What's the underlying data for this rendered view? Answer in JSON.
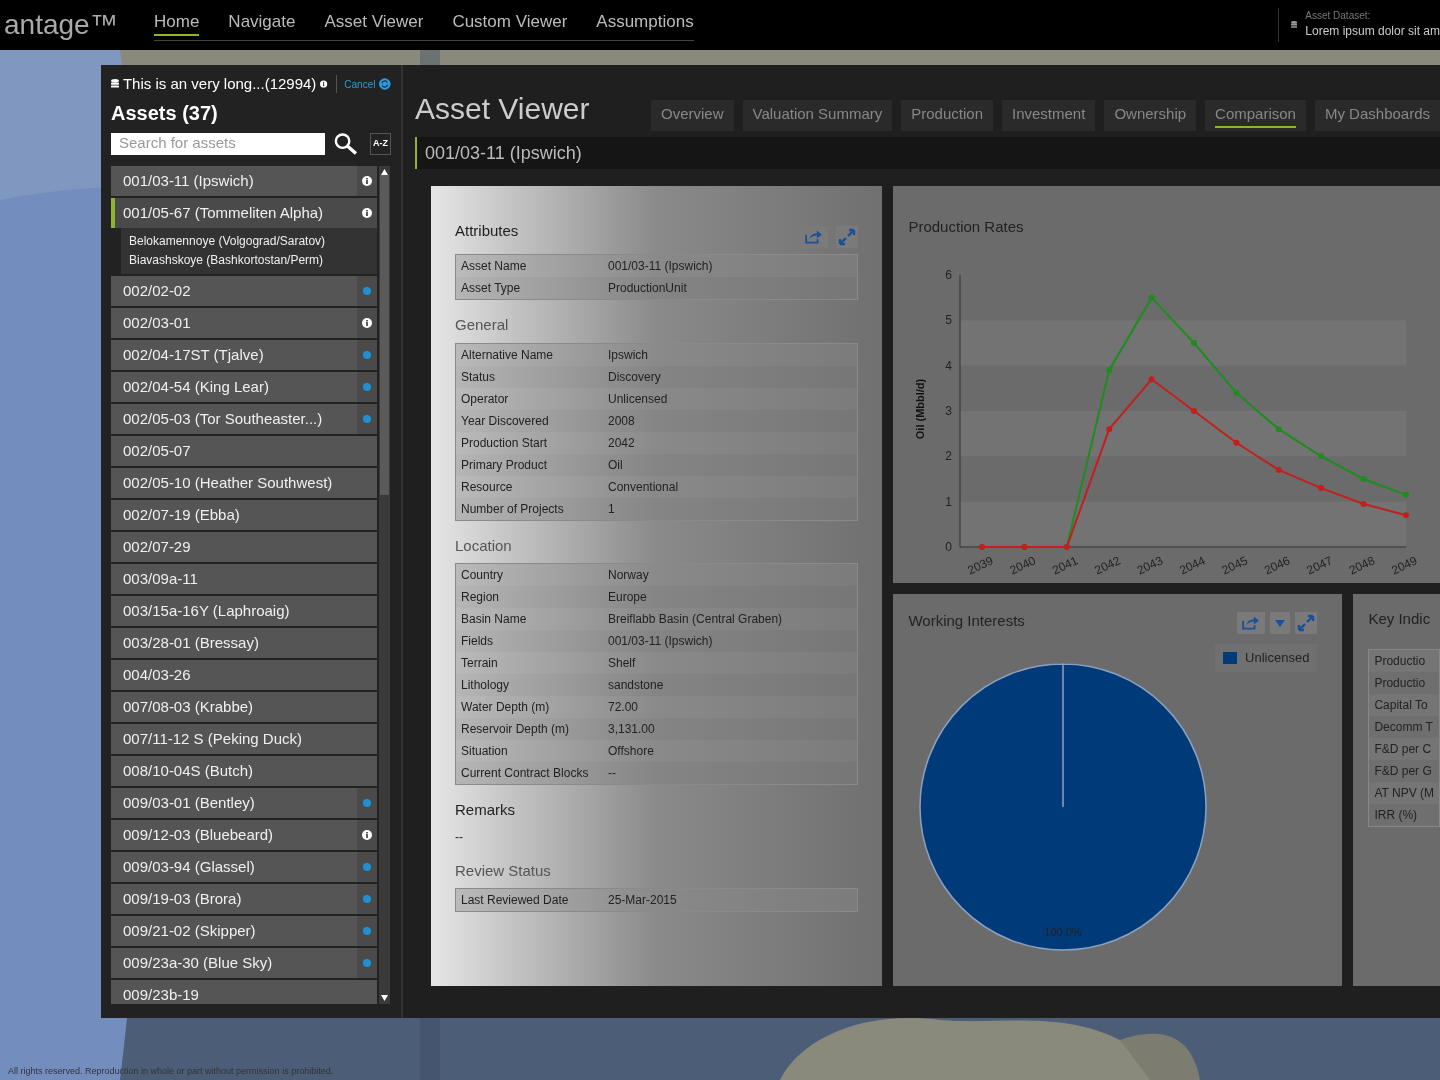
{
  "brand": "antage™",
  "nav": [
    {
      "label": "Home",
      "selected": true
    },
    {
      "label": "Navigate",
      "selected": false
    },
    {
      "label": "Asset Viewer",
      "selected": false
    },
    {
      "label": "Custom Viewer",
      "selected": false
    },
    {
      "label": "Assumptions",
      "selected": false
    }
  ],
  "dataset": {
    "label": "Asset Dataset:",
    "value": "Lorem ipsum dolor sit am"
  },
  "sidebar": {
    "dataset_name": "This is an very long...(12994)",
    "cancel": "Cancel",
    "title": "Assets (37)",
    "search": {
      "placeholder": "Search for assets"
    },
    "sort": "A-Z",
    "items": [
      {
        "label": "001/03-11 (Ipswich)",
        "kind": "info",
        "selected": false
      },
      {
        "label": "001/05-67 (Tommeliten Alpha)",
        "kind": "info",
        "selected": true,
        "expanded": true,
        "children": [
          "Belokamennoye (Volgograd/Saratov)",
          "Biavashskoye (Bashkortostan/Perm)"
        ]
      },
      {
        "label": "002/02-02",
        "kind": "loaded",
        "selected": false
      },
      {
        "label": "002/03-01",
        "kind": "info",
        "selected": false
      },
      {
        "label": "002/04-17ST (Tjalve)",
        "kind": "loaded",
        "selected": false
      },
      {
        "label": "002/04-54 (King Lear)",
        "kind": "loaded",
        "selected": false
      },
      {
        "label": "002/05-03 (Tor Southeaster...)",
        "kind": "loaded",
        "selected": false
      },
      {
        "label": "002/05-07",
        "kind": "plain",
        "selected": false
      },
      {
        "label": "002/05-10 (Heather Southwest)",
        "kind": "plain",
        "selected": false
      },
      {
        "label": "002/07-19 (Ebba)",
        "kind": "plain",
        "selected": false
      },
      {
        "label": "002/07-29",
        "kind": "plain",
        "selected": false
      },
      {
        "label": "003/09a-11",
        "kind": "plain",
        "selected": false
      },
      {
        "label": "003/15a-16Y (Laphroaig)",
        "kind": "plain",
        "selected": false
      },
      {
        "label": "003/28-01 (Bressay)",
        "kind": "plain",
        "selected": false
      },
      {
        "label": "004/03-26",
        "kind": "plain",
        "selected": false
      },
      {
        "label": "007/08-03 (Krabbe)",
        "kind": "plain",
        "selected": false
      },
      {
        "label": "007/11-12 S (Peking Duck)",
        "kind": "plain",
        "selected": false
      },
      {
        "label": "008/10-04S (Butch)",
        "kind": "plain",
        "selected": false
      },
      {
        "label": "009/03-01 (Bentley)",
        "kind": "loaded",
        "selected": false
      },
      {
        "label": "009/12-03 (Bluebeard)",
        "kind": "info",
        "selected": false
      },
      {
        "label": "009/03-94 (Glassel)",
        "kind": "loaded",
        "selected": false
      },
      {
        "label": "009/19-03 (Brora)",
        "kind": "loaded",
        "selected": false
      },
      {
        "label": "009/21-02 (Skipper)",
        "kind": "loaded",
        "selected": false
      },
      {
        "label": "009/23a-30 (Blue Sky)",
        "kind": "loaded",
        "selected": false
      },
      {
        "label": "009/23b-19",
        "kind": "plain",
        "selected": false
      }
    ]
  },
  "viewer": {
    "title": "Asset Viewer",
    "tabs": [
      {
        "label": "Overview",
        "selected": false
      },
      {
        "label": "Valuation Summary",
        "selected": false
      },
      {
        "label": "Production",
        "selected": false
      },
      {
        "label": "Investment",
        "selected": false
      },
      {
        "label": "Ownership",
        "selected": false
      },
      {
        "label": "Comparison",
        "selected": true
      },
      {
        "label": "My Dashboards",
        "selected": false
      }
    ],
    "breadcrumb": "001/03-11 (Ipswich)"
  },
  "attributes": {
    "title": "Attributes",
    "sections": [
      {
        "rows": [
          [
            "Asset Name",
            "001/03-11 (Ipswich)"
          ],
          [
            "Asset Type",
            "ProductionUnit"
          ]
        ]
      },
      {
        "heading": "General",
        "rows": [
          [
            "Alternative Name",
            "Ipswich"
          ],
          [
            "Status",
            "Discovery"
          ],
          [
            "Operator",
            "Unlicensed"
          ],
          [
            "Year Discovered",
            "2008"
          ],
          [
            "Production Start",
            "2042"
          ],
          [
            "Primary Product",
            "Oil"
          ],
          [
            "Resource",
            "Conventional"
          ],
          [
            "Number of Projects",
            "1"
          ]
        ]
      },
      {
        "heading": "Location",
        "rows": [
          [
            "Country",
            "Norway"
          ],
          [
            "Region",
            "Europe"
          ],
          [
            "Basin Name",
            "Breiflabb Basin (Central Graben)"
          ],
          [
            "Fields",
            "001/03-11 (Ipswich)"
          ],
          [
            "Terrain",
            "Shelf"
          ],
          [
            "Lithology",
            "sandstone"
          ],
          [
            "Water Depth (m)",
            "72.00"
          ],
          [
            "Reservoir Depth (m)",
            "3,131.00"
          ],
          [
            "Situation",
            "Offshore"
          ],
          [
            "Current Contract Blocks",
            "--"
          ]
        ]
      },
      {
        "heading": "Remarks",
        "text": "--"
      },
      {
        "heading": "Review Status",
        "rows": [
          [
            "Last Reviewed Date",
            "25-Mar-2015"
          ]
        ]
      }
    ]
  },
  "production": {
    "title": "Production Rates",
    "chart_data": {
      "type": "line",
      "ylabel": "Oil (Mbbl/d)",
      "categories": [
        "2039",
        "2040",
        "2041",
        "2042",
        "2043",
        "2044",
        "2045",
        "2046",
        "2047",
        "2048",
        "2049"
      ],
      "ylim": [
        0,
        6
      ],
      "yticks": [
        0,
        1,
        2,
        3,
        4,
        5,
        6
      ],
      "series": [
        {
          "color": "#1e8c1e",
          "marker": "circle",
          "values": [
            0,
            0,
            0,
            3.9,
            5.5,
            4.5,
            3.4,
            2.6,
            2.0,
            1.5,
            1.15
          ]
        },
        {
          "color": "#c21f1f",
          "marker": "circle",
          "values": [
            0,
            0,
            0,
            2.6,
            3.7,
            3.0,
            2.3,
            1.7,
            1.3,
            0.95,
            0.7
          ]
        }
      ]
    }
  },
  "working_interests": {
    "title": "Working Interests",
    "chart_data": {
      "type": "pie",
      "categories": [
        "Unlicensed"
      ],
      "series": [
        {
          "color": "#003a78",
          "values": [
            100
          ]
        }
      ],
      "value_labels": [
        "100.0%"
      ]
    }
  },
  "key_indicators": {
    "title": "Key Indic",
    "rows": [
      "Productio",
      "Productio",
      "Capital To",
      "Decomm T",
      "F&D per C",
      "F&D per G",
      "AT NPV (M",
      "IRR (%)"
    ]
  },
  "footer": "All rights reserved. Reproduction in whole or part without permission is prohibited."
}
